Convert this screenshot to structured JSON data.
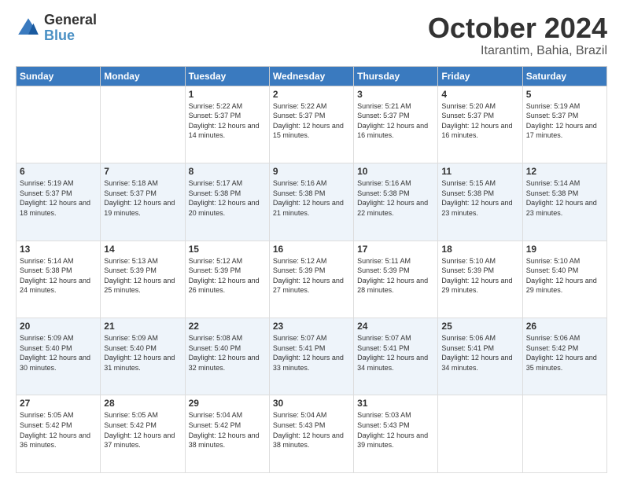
{
  "header": {
    "logo_line1": "General",
    "logo_line2": "Blue",
    "title": "October 2024",
    "subtitle": "Itarantim, Bahia, Brazil"
  },
  "days_of_week": [
    "Sunday",
    "Monday",
    "Tuesday",
    "Wednesday",
    "Thursday",
    "Friday",
    "Saturday"
  ],
  "weeks": [
    [
      {
        "day": "",
        "info": ""
      },
      {
        "day": "",
        "info": ""
      },
      {
        "day": "1",
        "info": "Sunrise: 5:22 AM\nSunset: 5:37 PM\nDaylight: 12 hours and 14 minutes."
      },
      {
        "day": "2",
        "info": "Sunrise: 5:22 AM\nSunset: 5:37 PM\nDaylight: 12 hours and 15 minutes."
      },
      {
        "day": "3",
        "info": "Sunrise: 5:21 AM\nSunset: 5:37 PM\nDaylight: 12 hours and 16 minutes."
      },
      {
        "day": "4",
        "info": "Sunrise: 5:20 AM\nSunset: 5:37 PM\nDaylight: 12 hours and 16 minutes."
      },
      {
        "day": "5",
        "info": "Sunrise: 5:19 AM\nSunset: 5:37 PM\nDaylight: 12 hours and 17 minutes."
      }
    ],
    [
      {
        "day": "6",
        "info": "Sunrise: 5:19 AM\nSunset: 5:37 PM\nDaylight: 12 hours and 18 minutes."
      },
      {
        "day": "7",
        "info": "Sunrise: 5:18 AM\nSunset: 5:37 PM\nDaylight: 12 hours and 19 minutes."
      },
      {
        "day": "8",
        "info": "Sunrise: 5:17 AM\nSunset: 5:38 PM\nDaylight: 12 hours and 20 minutes."
      },
      {
        "day": "9",
        "info": "Sunrise: 5:16 AM\nSunset: 5:38 PM\nDaylight: 12 hours and 21 minutes."
      },
      {
        "day": "10",
        "info": "Sunrise: 5:16 AM\nSunset: 5:38 PM\nDaylight: 12 hours and 22 minutes."
      },
      {
        "day": "11",
        "info": "Sunrise: 5:15 AM\nSunset: 5:38 PM\nDaylight: 12 hours and 23 minutes."
      },
      {
        "day": "12",
        "info": "Sunrise: 5:14 AM\nSunset: 5:38 PM\nDaylight: 12 hours and 23 minutes."
      }
    ],
    [
      {
        "day": "13",
        "info": "Sunrise: 5:14 AM\nSunset: 5:38 PM\nDaylight: 12 hours and 24 minutes."
      },
      {
        "day": "14",
        "info": "Sunrise: 5:13 AM\nSunset: 5:39 PM\nDaylight: 12 hours and 25 minutes."
      },
      {
        "day": "15",
        "info": "Sunrise: 5:12 AM\nSunset: 5:39 PM\nDaylight: 12 hours and 26 minutes."
      },
      {
        "day": "16",
        "info": "Sunrise: 5:12 AM\nSunset: 5:39 PM\nDaylight: 12 hours and 27 minutes."
      },
      {
        "day": "17",
        "info": "Sunrise: 5:11 AM\nSunset: 5:39 PM\nDaylight: 12 hours and 28 minutes."
      },
      {
        "day": "18",
        "info": "Sunrise: 5:10 AM\nSunset: 5:39 PM\nDaylight: 12 hours and 29 minutes."
      },
      {
        "day": "19",
        "info": "Sunrise: 5:10 AM\nSunset: 5:40 PM\nDaylight: 12 hours and 29 minutes."
      }
    ],
    [
      {
        "day": "20",
        "info": "Sunrise: 5:09 AM\nSunset: 5:40 PM\nDaylight: 12 hours and 30 minutes."
      },
      {
        "day": "21",
        "info": "Sunrise: 5:09 AM\nSunset: 5:40 PM\nDaylight: 12 hours and 31 minutes."
      },
      {
        "day": "22",
        "info": "Sunrise: 5:08 AM\nSunset: 5:40 PM\nDaylight: 12 hours and 32 minutes."
      },
      {
        "day": "23",
        "info": "Sunrise: 5:07 AM\nSunset: 5:41 PM\nDaylight: 12 hours and 33 minutes."
      },
      {
        "day": "24",
        "info": "Sunrise: 5:07 AM\nSunset: 5:41 PM\nDaylight: 12 hours and 34 minutes."
      },
      {
        "day": "25",
        "info": "Sunrise: 5:06 AM\nSunset: 5:41 PM\nDaylight: 12 hours and 34 minutes."
      },
      {
        "day": "26",
        "info": "Sunrise: 5:06 AM\nSunset: 5:42 PM\nDaylight: 12 hours and 35 minutes."
      }
    ],
    [
      {
        "day": "27",
        "info": "Sunrise: 5:05 AM\nSunset: 5:42 PM\nDaylight: 12 hours and 36 minutes."
      },
      {
        "day": "28",
        "info": "Sunrise: 5:05 AM\nSunset: 5:42 PM\nDaylight: 12 hours and 37 minutes."
      },
      {
        "day": "29",
        "info": "Sunrise: 5:04 AM\nSunset: 5:42 PM\nDaylight: 12 hours and 38 minutes."
      },
      {
        "day": "30",
        "info": "Sunrise: 5:04 AM\nSunset: 5:43 PM\nDaylight: 12 hours and 38 minutes."
      },
      {
        "day": "31",
        "info": "Sunrise: 5:03 AM\nSunset: 5:43 PM\nDaylight: 12 hours and 39 minutes."
      },
      {
        "day": "",
        "info": ""
      },
      {
        "day": "",
        "info": ""
      }
    ]
  ]
}
